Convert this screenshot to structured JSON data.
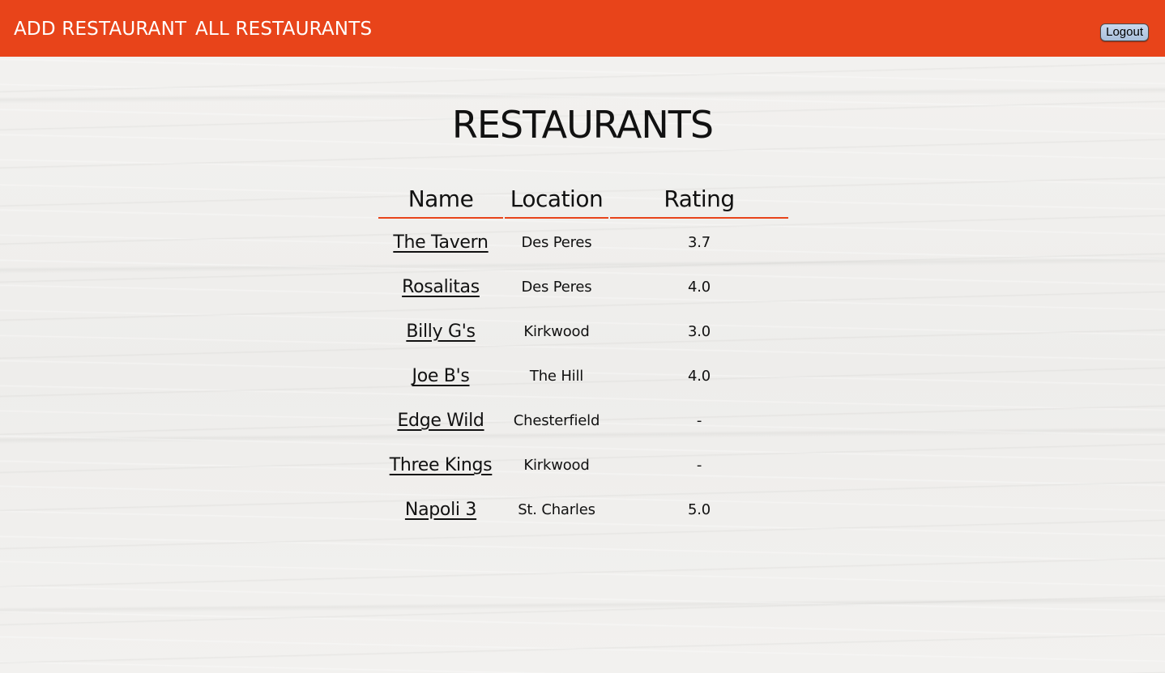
{
  "nav": {
    "add_restaurant": "ADD RESTAURANT",
    "all_restaurants": "ALL RESTAURANTS",
    "logout": "Logout"
  },
  "page": {
    "title": "RESTAURANTS"
  },
  "table": {
    "headers": {
      "name": "Name",
      "location": "Location",
      "rating": "Rating"
    },
    "rows": [
      {
        "name": "The Tavern",
        "location": "Des Peres",
        "rating": "3.7"
      },
      {
        "name": "Rosalitas",
        "location": "Des Peres",
        "rating": "4.0"
      },
      {
        "name": "Billy G's",
        "location": "Kirkwood",
        "rating": "3.0"
      },
      {
        "name": "Joe B's",
        "location": "The Hill",
        "rating": "4.0"
      },
      {
        "name": "Edge Wild",
        "location": "Chesterfield",
        "rating": "-"
      },
      {
        "name": "Three Kings",
        "location": "Kirkwood",
        "rating": "-"
      },
      {
        "name": "Napoli 3",
        "location": "St. Charles",
        "rating": "5.0"
      }
    ]
  },
  "colors": {
    "accent": "#e8441a",
    "text": "#111111",
    "background": "#f1f0ee"
  }
}
